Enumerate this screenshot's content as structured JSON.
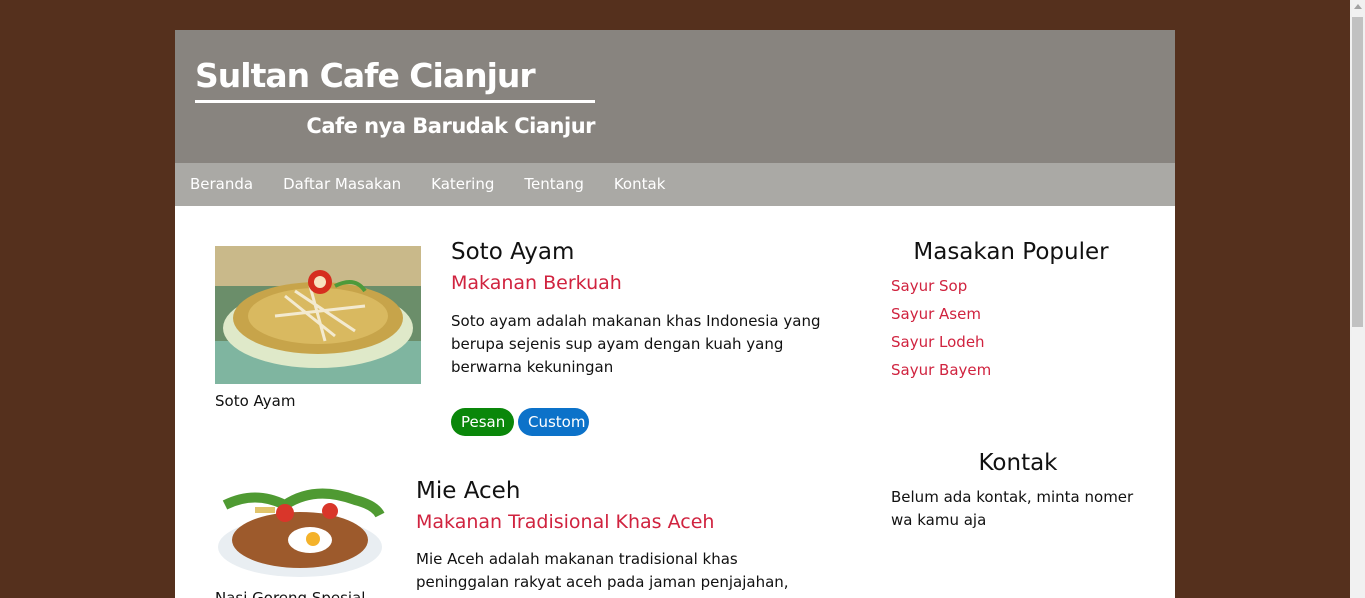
{
  "header": {
    "title": "Sultan Cafe Cianjur",
    "tagline": "Cafe nya Barudak Cianjur"
  },
  "nav": {
    "items": [
      "Beranda",
      "Daftar Masakan",
      "Katering",
      "Tentang",
      "Kontak"
    ]
  },
  "articles": [
    {
      "caption": "Soto Ayam",
      "title": "Soto Ayam",
      "subtitle": "Makanan Berkuah",
      "text": "Soto ayam adalah makanan khas Indonesia yang berupa sejenis sup ayam dengan kuah yang berwarna kekuningan",
      "buttons": [
        "Pesan",
        "Custom"
      ]
    },
    {
      "caption": "Nasi Goreng Spesial",
      "title": "Mie Aceh",
      "subtitle": "Makanan Tradisional Khas Aceh",
      "text": "Mie Aceh adalah makanan tradisional khas peninggalan rakyat aceh pada jaman penjajahan,"
    }
  ],
  "sidebar": {
    "popular_heading": "Masakan Populer",
    "popular_items": [
      "Sayur Sop",
      "Sayur Asem",
      "Sayur Lodeh",
      "Sayur Bayem"
    ],
    "contact_heading": "Kontak",
    "contact_text": "Belum ada kontak, minta nomer wa kamu aja"
  },
  "colors": {
    "page_bg": "#55301d",
    "header_bg": "#88847f",
    "nav_bg": "#aaa9a5",
    "accent_red": "#d0233f",
    "pesan_green": "#0a870a",
    "custom_blue": "#0c72c9"
  }
}
